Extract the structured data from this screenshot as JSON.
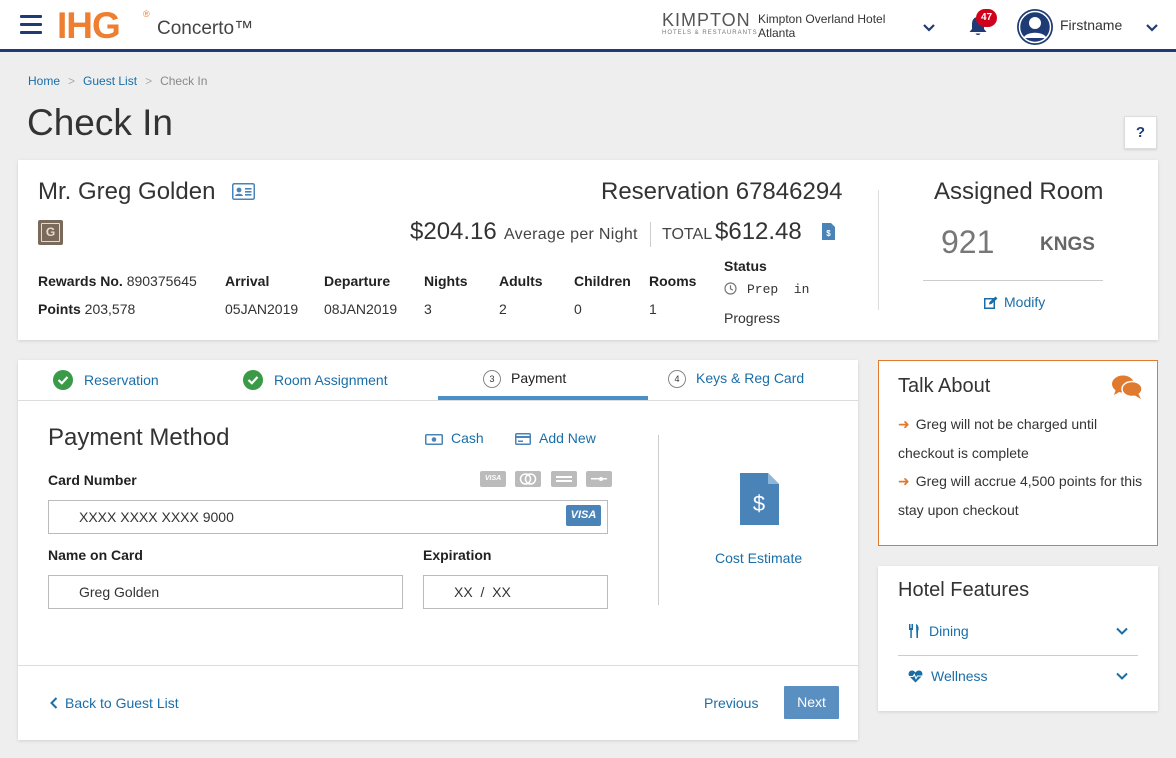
{
  "header": {
    "brand": "IHG",
    "brand_mark": "®",
    "product": "Concerto™",
    "hotel_brand": "KIMPTON",
    "hotel_brand_sub": "HOTELS & RESTAURANTS",
    "hotel_name": "Kimpton Overland Hotel Atlanta",
    "notifications_count": "47",
    "user_name": "Firstname"
  },
  "breadcrumb": [
    "Home",
    "Guest List",
    "Check In"
  ],
  "page_title": "Check In",
  "help_label": "?",
  "guest": {
    "name": "Mr. Greg Golden",
    "tier_letter": "G",
    "reservation": "Reservation 67846294",
    "avg_price": "$204.16",
    "avg_label": "Average per Night",
    "total_label": "TOTAL",
    "total_price": "$612.48",
    "rewards_label": "Rewards No.",
    "rewards_no": "890375645",
    "points_label": "Points",
    "points": "203,578",
    "columns": [
      {
        "label": "Arrival",
        "value": "05JAN2019"
      },
      {
        "label": "Departure",
        "value": "08JAN2019"
      },
      {
        "label": "Nights",
        "value": "3"
      },
      {
        "label": "Adults",
        "value": "2"
      },
      {
        "label": "Children",
        "value": "0"
      },
      {
        "label": "Rooms",
        "value": "1"
      }
    ],
    "status_label": "Status",
    "status_line1": "Prep  in",
    "status_line2": "Progress"
  },
  "room": {
    "title": "Assigned Room",
    "number": "921",
    "type": "KNGS",
    "modify_label": "Modify"
  },
  "steps": [
    {
      "label": "Reservation",
      "state": "done"
    },
    {
      "label": "Room Assignment",
      "state": "done"
    },
    {
      "label": "Payment",
      "number": "3",
      "state": "active"
    },
    {
      "label": "Keys & Reg Card",
      "number": "4",
      "state": "todo"
    }
  ],
  "payment": {
    "title": "Payment Method",
    "cash_label": "Cash",
    "add_new_label": "Add New",
    "card_number_label": "Card Number",
    "card_number_value": "XXXX  XXXX  XXXX  9000",
    "card_brand": "VISA",
    "card_icons": [
      "VISA",
      "MC",
      "AMEX",
      "DISC"
    ],
    "name_label": "Name on Card",
    "name_value": "Greg Golden",
    "expiration_label": "Expiration",
    "expiration_value": "XX  /  XX",
    "cost_estimate_label": "Cost Estimate"
  },
  "footer": {
    "back_label": "Back to Guest List",
    "previous_label": "Previous",
    "next_label": "Next"
  },
  "talk_about": {
    "title": "Talk About",
    "items": [
      "Greg will not be charged until checkout is complete",
      "Greg will accrue 4,500 points for this stay upon checkout"
    ]
  },
  "features": {
    "title": "Hotel Features",
    "items": [
      "Dining",
      "Wellness"
    ]
  },
  "colors": {
    "brand_orange": "#ee7e30",
    "navy": "#1f3b73",
    "link_blue": "#1a6ea8",
    "success_green": "#3a9a47",
    "badge_red": "#d0021b"
  }
}
